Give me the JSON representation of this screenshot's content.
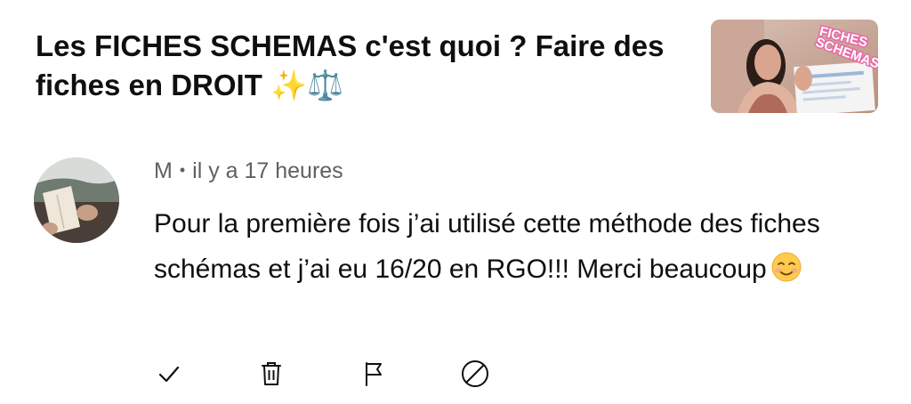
{
  "video": {
    "title": "Les FICHES SCHEMAS c'est quoi ? Faire des fiches en DROIT ✨⚖️",
    "thumbnail_text": "FICHES SCHEMAS"
  },
  "comment": {
    "author": "M",
    "separator": "•",
    "time": "il y a 17 heures",
    "text": "Pour la première fois j’ai utilisé cette méthode des fiches schémas et j’ai eu 16/20 en RGO!!! Merci beaucoup"
  },
  "actions": {
    "icons": [
      "checkmark-icon",
      "trash-icon",
      "flag-icon",
      "block-icon"
    ]
  },
  "colors": {
    "text_primary": "#0f0f0f",
    "text_secondary": "#606060",
    "thumbnail_accent": "#e96aa6"
  }
}
